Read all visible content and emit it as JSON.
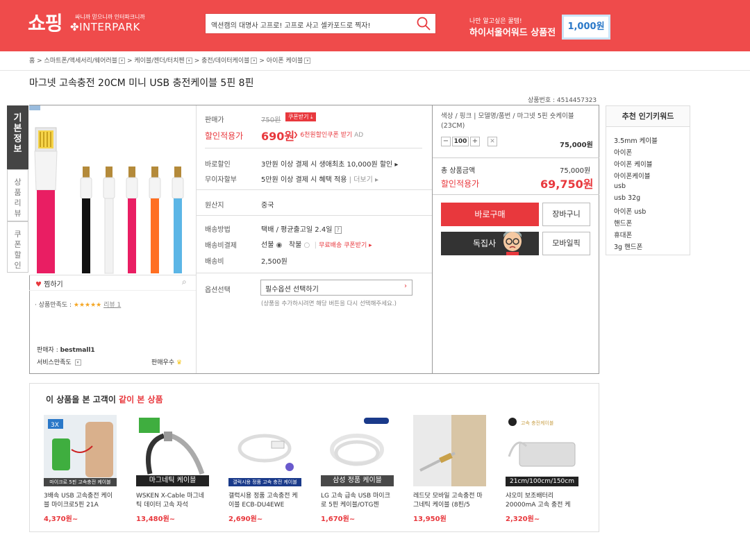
{
  "header": {
    "logo_main": "쇼핑",
    "logo_sub": "싸니까 믿으니까 인터파크니까",
    "logo_name": "INTERPARK",
    "search_value": "액션캠의 대명사 고프로! 고프로 사고 셀카포드로 찍자!",
    "promo_line1": "나만 알고싶은 꿀템!",
    "promo_line2": "하이서울어워드 상품전",
    "coupon": "1,000원"
  },
  "breadcrumb": [
    "홈",
    "스마트폰/액세서리/웨어러블",
    "케이블/젠더/터치펜",
    "충전/데이터케이블",
    "아이폰 케이블"
  ],
  "product": {
    "title": "마그넷 고속충전 20CM 미니 USB 충전케이블 5핀 8핀",
    "number_label": "상품번호 :",
    "number": "4514457323",
    "tabs": [
      "기본정보",
      "상품리뷰",
      "쿠폰할인"
    ],
    "like": "찜하기",
    "satisfaction_label": "· 상품만족도 :",
    "stars": "★★★★★",
    "review": "리뷰 1",
    "seller_label": "판매자 :",
    "seller": "bestmall1",
    "service": "서비스만족도",
    "seller_grade": "판매우수"
  },
  "price": {
    "sale_label": "판매가",
    "orig_price": "750원",
    "coupon_btn": "쿠폰받기",
    "discount_label": "할인적용가",
    "discount_price": "690원",
    "coupon_link": "6천원할인쿠폰 받기",
    "ad": "AD",
    "instant_label": "바로할인",
    "instant_val": "3만원 이상 결제 시 생애최초 10,000원 할인",
    "install_label": "무이자할부",
    "install_val": "5만원 이상 결제 시 혜택 적용",
    "more": "더보기",
    "origin_label": "원산지",
    "origin_val": "중국",
    "ship_method_label": "배송방법",
    "ship_method_val": "택배 / 평균출고일 2.4일",
    "ship_pay_label": "배송비결제",
    "ship_prepaid": "선불",
    "ship_cod": "착불",
    "ship_coupon": "무료배송 쿠폰받기",
    "ship_fee_label": "배송비",
    "ship_fee_val": "2,500원",
    "option_label": "옵션선택",
    "option_placeholder": "필수옵션 선택하기",
    "option_hint": "(상품을 추가하시려면 해당 버튼을 다시 선택해주세요.)"
  },
  "order": {
    "option_text": "색상 / 핑크 | 모델명/품번 / 마그넷 5핀 숏케이블(23CM)",
    "qty": "100",
    "line_price": "75,000원",
    "total_label": "총 상품금액",
    "total_val": "75,000원",
    "final_label": "할인적용가",
    "final_val": "69,750원",
    "buy_btn": "바로구매",
    "cart_btn": "장바구니",
    "exclusive_btn": "독집사",
    "mobile_btn": "모바일픽"
  },
  "recommend": {
    "title": "추천 인기키워드",
    "items": [
      "3.5mm 케이블",
      "아이폰",
      "아이폰 케이블",
      "아이폰케이블",
      "usb",
      "usb 32g",
      "아이폰 usb",
      "핸드폰",
      "휴대폰",
      "3g 핸드폰"
    ]
  },
  "also": {
    "title_a": "이 상품을 본 고객이",
    "title_b": "같이 본 상품",
    "items": [
      {
        "label": "마이크로 5핀 고속충전 케이블",
        "name": "3배속 USB 고속충전 케이블 마이크로5핀 21A",
        "price": "4,370원~"
      },
      {
        "label": "마그네틱 케이블",
        "name": "WSKEN X-Cable 마그네틱 데이터 고속 자석",
        "price": "13,480원~"
      },
      {
        "label": "갤럭시용 정품 고속 충전 케이블",
        "name": "갤럭시용 정품 고속충전 케이블 ECB-DU4EWE",
        "price": "2,690원~"
      },
      {
        "label": "삼성 정품 케이블",
        "name": "LG 고속 급속 USB 마이크로 5핀 케이블/OTG젠",
        "price": "1,670원~"
      },
      {
        "label": "",
        "name": "레드닷 모바일 고속충전 마그네틱 케이블 (8핀/5",
        "price": "13,950원"
      },
      {
        "label": "21cm/100cm/150cm",
        "name": "샤오미 보조배터리 20000mA 고속 충전 케",
        "price": "2,320원~"
      }
    ]
  },
  "colors": {
    "brand": "#ef4b4b",
    "accent": "#e8383d",
    "dark": "#444444"
  }
}
